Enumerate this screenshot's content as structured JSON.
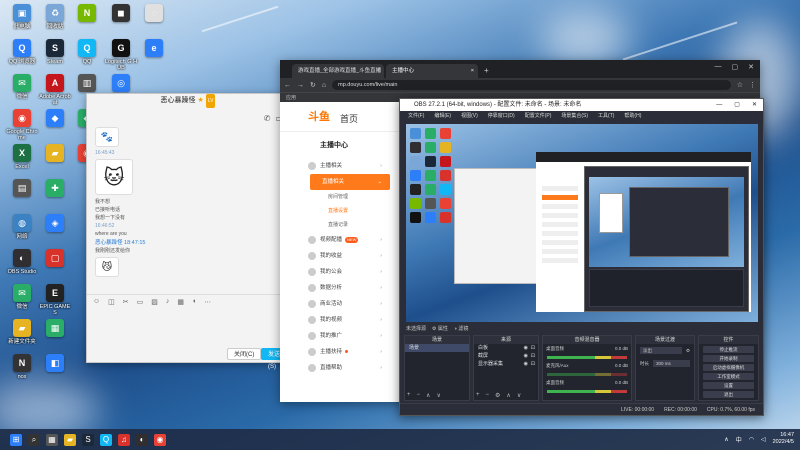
{
  "desktop": {
    "icons": [
      {
        "label": "此电脑",
        "color": "#4a90d9",
        "glyph": "▣"
      },
      {
        "label": "QQ 浏览器",
        "color": "#2d7ff9",
        "glyph": "Q"
      },
      {
        "label": "微信",
        "color": "#2aae67",
        "glyph": "✉"
      },
      {
        "label": "Google Chrome",
        "color": "#e94235",
        "glyph": "◉"
      },
      {
        "label": "Excel",
        "color": "#1d7044",
        "glyph": "X"
      },
      {
        "label": "",
        "color": "#555",
        "glyph": "▤"
      },
      {
        "label": "网络",
        "color": "#3b82c4",
        "glyph": "◍"
      },
      {
        "label": "OBS Studio",
        "color": "#302e31",
        "glyph": "◐"
      },
      {
        "label": "微信",
        "color": "#2aae67",
        "glyph": "✉"
      },
      {
        "label": "新建文件夹",
        "color": "#e6b422",
        "glyph": "▰"
      },
      {
        "label": "nox",
        "color": "#333",
        "glyph": "N"
      },
      {
        "label": "回收站",
        "color": "#7aa7d8",
        "glyph": "♻"
      },
      {
        "label": "Steam",
        "color": "#1b2838",
        "glyph": "S"
      },
      {
        "label": "Adobe Acrobat",
        "color": "#c4161c",
        "glyph": "A"
      },
      {
        "label": "",
        "color": "#2d7ff9",
        "glyph": "◆"
      },
      {
        "label": "",
        "color": "#e6b422",
        "glyph": "▰"
      },
      {
        "label": "",
        "color": "#2aae67",
        "glyph": "✚"
      },
      {
        "label": "",
        "color": "#2d7ff9",
        "glyph": "◈"
      },
      {
        "label": "",
        "color": "#d9322b",
        "glyph": "▢"
      },
      {
        "label": "EPIC GAMES",
        "color": "#222",
        "glyph": "E"
      },
      {
        "label": "",
        "color": "#2aae67",
        "glyph": "▦"
      },
      {
        "label": "",
        "color": "#2d7ff9",
        "glyph": "◧"
      },
      {
        "label": "",
        "color": "#76b900",
        "glyph": "N"
      },
      {
        "label": "QQ",
        "color": "#12b7f5",
        "glyph": "Q"
      },
      {
        "label": "",
        "color": "#555",
        "glyph": "▥"
      },
      {
        "label": "",
        "color": "#2aae67",
        "glyph": "◆"
      },
      {
        "label": "",
        "color": "#e94235",
        "glyph": "◉"
      },
      {
        "label": "",
        "color": "#333",
        "glyph": "◼"
      },
      {
        "label": "Logitech G HUB",
        "color": "#111",
        "glyph": "G"
      },
      {
        "label": "",
        "color": "#2d7ff9",
        "glyph": "◎"
      },
      {
        "label": "",
        "color": "#e0e0e0",
        "glyph": "◌"
      },
      {
        "label": "",
        "color": "#2d7ff9",
        "glyph": "e"
      },
      {
        "label": "网易云音乐",
        "color": "#d9322b",
        "glyph": "♫"
      },
      {
        "label": "Debug",
        "color": "#3b5b8c",
        "glyph": "◉"
      }
    ]
  },
  "chat": {
    "title": "恶心暴躁怪",
    "badge": "LV",
    "messages": [
      {
        "kind": "time",
        "text": "16:45:43"
      },
      {
        "kind": "text",
        "text": "我不想"
      },
      {
        "kind": "text",
        "text": "已接听电话"
      },
      {
        "kind": "text",
        "text": "我想一下没有"
      },
      {
        "kind": "time",
        "text": "16:46:52"
      },
      {
        "kind": "text",
        "text": "where are you"
      },
      {
        "kind": "name",
        "text": "恶心暴躁怪 18:47:15"
      },
      {
        "kind": "text",
        "text": "我刚刚还发给你"
      }
    ],
    "close_label": "关闭(C)",
    "send_label": "发送(S)"
  },
  "chrome": {
    "tabs": [
      {
        "title": "游戏直播_全部游戏直播_斗鱼直播"
      },
      {
        "title": "主播中心"
      }
    ],
    "url": "mp.douyu.com/live/main",
    "bookmarks": "应用",
    "logo": "斗鱼",
    "home": "首页",
    "sidebar_title": "主播中心",
    "menu": [
      {
        "label": "主播相关",
        "kind": "item"
      },
      {
        "label": "直播相关",
        "kind": "active"
      },
      {
        "label": "房间管理",
        "kind": "sub"
      },
      {
        "label": "直播设置",
        "kind": "sub-on"
      },
      {
        "label": "直播记录",
        "kind": "sub"
      },
      {
        "label": "视频配播",
        "kind": "item",
        "hot": "NEW"
      },
      {
        "label": "我的收益",
        "kind": "item"
      },
      {
        "label": "我的公会",
        "kind": "item"
      },
      {
        "label": "数据分析",
        "kind": "item"
      },
      {
        "label": "商业活动",
        "kind": "item"
      },
      {
        "label": "我的视频",
        "kind": "item"
      },
      {
        "label": "我的推广",
        "kind": "item"
      },
      {
        "label": "主播扶持",
        "kind": "item",
        "dot": true
      },
      {
        "label": "直播帮助",
        "kind": "item"
      }
    ]
  },
  "obs": {
    "title": "OBS 27.2.1 (64-bit, windows) - 配置文件: 未命名 - 场景: 未命名",
    "menu": [
      "文件(F)",
      "编辑(E)",
      "视图(V)",
      "停靠窗口(D)",
      "配置文件(P)",
      "场景集合(S)",
      "工具(T)",
      "帮助(H)"
    ],
    "preview_tabs": [
      "未选择源",
      "属性",
      "滤镜"
    ],
    "docks": {
      "scenes": {
        "header": "场景",
        "items": [
          "场景"
        ]
      },
      "sources": {
        "header": "来源",
        "items": [
          "白板",
          "截屏",
          "显示器采集"
        ]
      },
      "mixer": {
        "header": "音频混音器",
        "channels": [
          {
            "name": "桌面音频",
            "level": "0.0 dB"
          },
          {
            "name": "麦克风/Aux",
            "level": "0.0 dB"
          },
          {
            "name": "桌面音频",
            "level": "0.0 dB"
          }
        ]
      },
      "transitions": {
        "header": "场景过渡",
        "type": "淡出",
        "duration_label": "时长",
        "duration": "300 ms"
      },
      "controls": {
        "header": "控件",
        "buttons": [
          "停止推流",
          "开始录制",
          "启动虚拟摄像机",
          "工作室模式",
          "设置",
          "退出"
        ]
      }
    },
    "status": [
      "LIVE: 00:00:00",
      "REC: 00:00:00",
      "CPU: 0.7%, 60.00 fps"
    ]
  },
  "taskbar": {
    "time": "16:47",
    "date": "2022/4/5",
    "lang": "中",
    "apps": [
      {
        "color": "#2d7ff9",
        "glyph": "⊞"
      },
      {
        "color": "#333",
        "glyph": "⌕"
      },
      {
        "color": "#555",
        "glyph": "▦"
      },
      {
        "color": "#e6b422",
        "glyph": "▰"
      },
      {
        "color": "#1b2838",
        "glyph": "S"
      },
      {
        "color": "#12b7f5",
        "glyph": "Q"
      },
      {
        "color": "#d9322b",
        "glyph": "♫"
      },
      {
        "color": "#302e31",
        "glyph": "◐"
      },
      {
        "color": "#e94235",
        "glyph": "◉"
      }
    ]
  }
}
